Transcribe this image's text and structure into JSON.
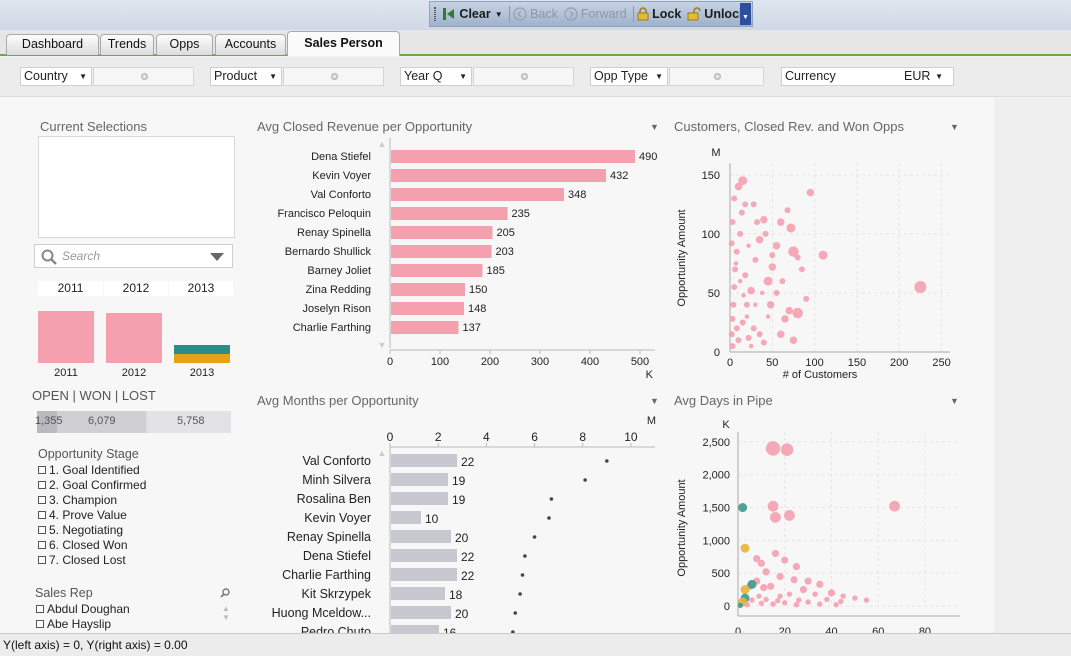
{
  "toolbar": {
    "clear": "Clear",
    "back": "Back",
    "forward": "Forward",
    "lock": "Lock",
    "unlock": "Unlock"
  },
  "tabs": [
    "Dashboard",
    "Trends",
    "Opps",
    "Accounts",
    "Sales Person"
  ],
  "active_tab": "Sales Person",
  "filters": {
    "country": "Country",
    "product": "Product",
    "year_q": "Year Q",
    "opp_type": "Opp Type",
    "currency_label": "Currency",
    "currency_value": "EUR"
  },
  "left": {
    "current_selections": "Current Selections",
    "search_placeholder": "Search",
    "years": [
      "2011",
      "2012",
      "2013"
    ],
    "year_bars": {
      "labels": [
        "2011",
        "2012",
        "2013"
      ],
      "heights": [
        1.0,
        0.96,
        0.36
      ]
    },
    "status_title": "OPEN | WON | LOST",
    "status_values": [
      "1,355",
      "6,079",
      "5,758"
    ],
    "opp_stage_title": "Opportunity Stage",
    "opp_stages": [
      "1. Goal Identified",
      "2. Goal Confirmed",
      "3. Champion",
      "4. Prove Value",
      "5. Negotiating",
      "6. Closed Won",
      "7. Closed Lost"
    ],
    "sales_rep_title": "Sales Rep",
    "sales_reps": [
      "Abdul  Doughan",
      "Abe  Hayslip"
    ]
  },
  "charts_titles": {
    "avg_closed_revenue": "Avg Closed Revenue per Opportunity",
    "customers_rev_won": "Customers, Closed Rev. and Won Opps",
    "avg_months": "Avg Months per Opportunity",
    "avg_days_pipe": "Avg Days in Pipe"
  },
  "chart_data": [
    {
      "type": "bar",
      "orientation": "horizontal",
      "title": "Avg Closed Revenue per Opportunity",
      "unit": "K",
      "categories": [
        "Dena  Stiefel",
        "Kevin  Voyer",
        "Val  Conforto",
        "Francisco  Peloquin",
        "Renay  Spinella",
        "Bernardo  Shullick",
        "Barney  Joliet",
        "Zina  Redding",
        "Joselyn  Rison",
        "Charlie  Farthing"
      ],
      "values": [
        490,
        432,
        348,
        235,
        205,
        203,
        185,
        150,
        148,
        137
      ],
      "xticks": [
        "0",
        "100",
        "200",
        "300",
        "400",
        "500"
      ],
      "xlim": [
        0,
        530
      ],
      "color": "#f4a0ae"
    },
    {
      "type": "scatter",
      "title": "Customers, Closed Rev. and Won Opps",
      "xlabel": "# of Customers",
      "ylabel": "Opportunity Amount",
      "yunit": "M",
      "xticks": [
        "0",
        "50",
        "100",
        "150",
        "200",
        "250"
      ],
      "yticks": [
        "0",
        "50",
        "100",
        "150"
      ],
      "xlim": [
        0,
        260
      ],
      "ylim": [
        0,
        160
      ],
      "color": "#f4a0ae",
      "points": [
        [
          225,
          55,
          8
        ],
        [
          110,
          82,
          6
        ],
        [
          95,
          135,
          5
        ],
        [
          72,
          105,
          6
        ],
        [
          75,
          85,
          7
        ],
        [
          40,
          112,
          5
        ],
        [
          15,
          145,
          6
        ],
        [
          10,
          140,
          5
        ],
        [
          60,
          110,
          5
        ],
        [
          55,
          90,
          5
        ],
        [
          50,
          72,
          5
        ],
        [
          45,
          60,
          6
        ],
        [
          48,
          40,
          5
        ],
        [
          65,
          28,
          5
        ],
        [
          80,
          33,
          7
        ],
        [
          70,
          35,
          5
        ],
        [
          60,
          15,
          5
        ],
        [
          75,
          10,
          5
        ],
        [
          35,
          95,
          5
        ],
        [
          30,
          78,
          4
        ],
        [
          25,
          52,
          5
        ],
        [
          20,
          40,
          4
        ],
        [
          18,
          65,
          4
        ],
        [
          12,
          100,
          4
        ],
        [
          14,
          118,
          4
        ],
        [
          8,
          85,
          4
        ],
        [
          6,
          70,
          4
        ],
        [
          5,
          55,
          4
        ],
        [
          4,
          40,
          4
        ],
        [
          3,
          28,
          4
        ],
        [
          2,
          15,
          4
        ],
        [
          3,
          5,
          4
        ],
        [
          8,
          20,
          4
        ],
        [
          10,
          10,
          4
        ],
        [
          15,
          25,
          4
        ],
        [
          22,
          12,
          4
        ],
        [
          28,
          20,
          4
        ],
        [
          35,
          15,
          4
        ],
        [
          40,
          8,
          4
        ],
        [
          5,
          130,
          4
        ],
        [
          3,
          110,
          4
        ],
        [
          2,
          92,
          4
        ],
        [
          7,
          75,
          3
        ],
        [
          12,
          60,
          3
        ],
        [
          16,
          48,
          3
        ],
        [
          20,
          30,
          3
        ],
        [
          25,
          5,
          3
        ],
        [
          30,
          40,
          3
        ],
        [
          45,
          30,
          3
        ],
        [
          38,
          50,
          3
        ],
        [
          22,
          90,
          3
        ],
        [
          18,
          125,
          4
        ],
        [
          28,
          125,
          4
        ],
        [
          32,
          110,
          4
        ],
        [
          42,
          100,
          4
        ],
        [
          50,
          82,
          4
        ],
        [
          55,
          50,
          4
        ],
        [
          62,
          60,
          4
        ],
        [
          85,
          70,
          4
        ],
        [
          90,
          45,
          4
        ],
        [
          80,
          80,
          4
        ],
        [
          68,
          120,
          4
        ]
      ]
    },
    {
      "type": "bar",
      "orientation": "horizontal",
      "title": "Avg Months per Opportunity",
      "unit": "M",
      "categories": [
        "Val  Conforto",
        "Minh  Silvera",
        "Rosalina  Ben",
        "Kevin  Voyer",
        "Renay  Spinella",
        "Dena  Stiefel",
        "Charlie  Farthing",
        "Kit  Skrzypek",
        "Huong  Mceldow...",
        "Pedro  Chuto"
      ],
      "values": [
        22,
        19,
        19,
        10,
        20,
        22,
        22,
        18,
        20,
        16
      ],
      "dots": [
        9.0,
        8.1,
        6.7,
        6.6,
        6.0,
        5.6,
        5.5,
        5.4,
        5.2,
        5.1
      ],
      "xticks": [
        "0",
        "2",
        "4",
        "6",
        "8",
        "10"
      ],
      "xlim": [
        0,
        11
      ],
      "color": "#c7c8cf"
    },
    {
      "type": "scatter",
      "title": "Avg Days in Pipe",
      "ylabel": "Opportunity Amount",
      "yunit": "K",
      "xticks": [
        "0",
        "20",
        "40",
        "60",
        "80"
      ],
      "yticks": [
        "0",
        "500",
        "1,000",
        "1,500",
        "2,000",
        "2,500"
      ],
      "xlim": [
        0,
        95
      ],
      "ylim": [
        0,
        2650
      ],
      "color": "#f4a0ae",
      "points": [
        [
          15,
          2400,
          8
        ],
        [
          21,
          2380,
          7
        ],
        [
          67,
          1520,
          6
        ],
        [
          15,
          1520,
          6
        ],
        [
          22,
          1380,
          6
        ],
        [
          16,
          1350,
          6
        ],
        [
          2,
          1500,
          5,
          "#3e9a8a"
        ],
        [
          3,
          880,
          5,
          "#e8b23a"
        ],
        [
          8,
          720,
          4
        ],
        [
          10,
          650,
          4
        ],
        [
          16,
          800,
          4
        ],
        [
          20,
          700,
          4
        ],
        [
          25,
          600,
          4
        ],
        [
          12,
          520,
          4
        ],
        [
          18,
          450,
          4
        ],
        [
          24,
          400,
          4
        ],
        [
          30,
          380,
          4
        ],
        [
          35,
          330,
          4
        ],
        [
          8,
          380,
          4
        ],
        [
          5,
          300,
          4
        ],
        [
          6,
          330,
          5,
          "#3e9a8a"
        ],
        [
          3,
          250,
          5,
          "#e8b23a"
        ],
        [
          11,
          280,
          4
        ],
        [
          14,
          300,
          4
        ],
        [
          28,
          250,
          4
        ],
        [
          40,
          200,
          4
        ],
        [
          45,
          150,
          3
        ],
        [
          50,
          120,
          3
        ],
        [
          55,
          90,
          3
        ],
        [
          33,
          180,
          3
        ],
        [
          22,
          180,
          3
        ],
        [
          18,
          150,
          3
        ],
        [
          9,
          150,
          3
        ],
        [
          3,
          120,
          5,
          "#3e9a8a"
        ],
        [
          2,
          60,
          5,
          "#e8b23a"
        ],
        [
          6,
          90,
          3
        ],
        [
          12,
          100,
          3
        ],
        [
          17,
          80,
          3
        ],
        [
          26,
          90,
          3
        ],
        [
          38,
          100,
          3
        ],
        [
          44,
          70,
          3
        ],
        [
          30,
          60,
          3
        ],
        [
          20,
          50,
          3
        ],
        [
          10,
          40,
          3
        ],
        [
          15,
          30,
          3
        ],
        [
          25,
          20,
          3
        ],
        [
          35,
          30,
          3
        ],
        [
          42,
          20,
          3
        ],
        [
          4,
          20,
          3
        ],
        [
          1,
          10,
          3,
          "#3e9a8a"
        ]
      ]
    }
  ],
  "status_bar": "Y(left axis) = 0, Y(right axis) = 0.00"
}
